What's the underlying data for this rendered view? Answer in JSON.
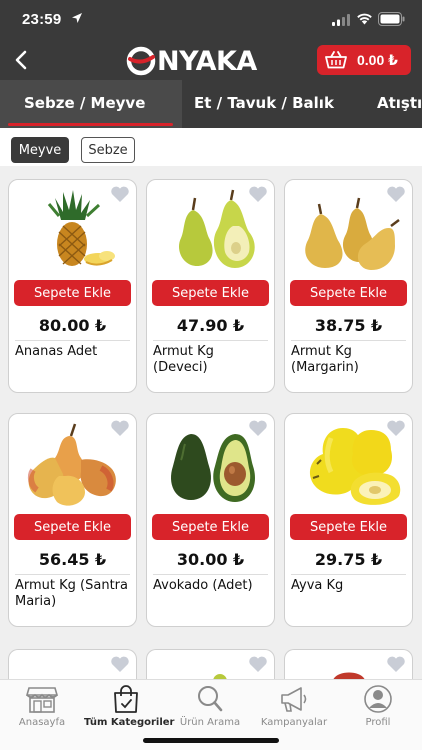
{
  "status": {
    "time": "23:59"
  },
  "header": {
    "logo_text": "NYAKA",
    "cart_total": "0.00 ₺",
    "brand_color": "#d8232a",
    "bar_color": "#3a3a3a"
  },
  "tabs": [
    {
      "label": "Sebze / Meyve",
      "active": true
    },
    {
      "label": "Et / Tavuk / Balık",
      "active": false
    },
    {
      "label": "Atıştır",
      "active": false
    }
  ],
  "filters": [
    {
      "label": "Meyve",
      "active": true
    },
    {
      "label": "Sebze",
      "active": false
    }
  ],
  "products": [
    {
      "name": "Ananas Adet",
      "price": "80.00 ₺",
      "button": "Sepete Ekle",
      "image": "pineapple"
    },
    {
      "name": "Armut Kg (Deveci)",
      "price": "47.90 ₺",
      "button": "Sepete Ekle",
      "image": "green-pear"
    },
    {
      "name": "Armut Kg (Margarin)",
      "price": "38.75 ₺",
      "button": "Sepete Ekle",
      "image": "yellow-pear"
    },
    {
      "name": "Armut Kg (Santra Maria)",
      "price": "56.45 ₺",
      "button": "Sepete Ekle",
      "image": "red-pear"
    },
    {
      "name": "Avokado (Adet)",
      "price": "30.00 ₺",
      "button": "Sepete Ekle",
      "image": "avocado"
    },
    {
      "name": "Ayva Kg",
      "price": "29.75 ₺",
      "button": "Sepete Ekle",
      "image": "quince"
    }
  ],
  "bottom_nav": [
    {
      "label": "Anasayfa",
      "icon": "store-icon",
      "active": false
    },
    {
      "label": "Tüm Kategoriler",
      "icon": "shopping-bag-icon",
      "active": true
    },
    {
      "label": "Ürün Arama",
      "icon": "search-icon",
      "active": false
    },
    {
      "label": "Kampanyalar",
      "icon": "megaphone-icon",
      "active": false
    },
    {
      "label": "Profil",
      "icon": "user-icon",
      "active": false
    }
  ]
}
